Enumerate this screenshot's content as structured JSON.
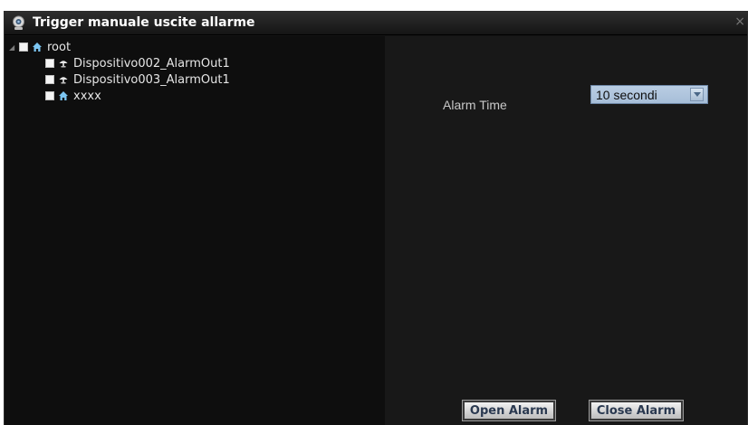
{
  "window": {
    "title": "Trigger manuale uscite allarme",
    "close_glyph": "×"
  },
  "tree": {
    "root": {
      "label": "root",
      "icon": "home-icon",
      "checked": false,
      "expanded": true
    },
    "items": [
      {
        "label": "Dispositivo002_AlarmOut1",
        "icon": "alarm-output-icon",
        "checked": false
      },
      {
        "label": "Dispositivo003_AlarmOut1",
        "icon": "alarm-output-icon",
        "checked": false
      },
      {
        "label": "xxxx",
        "icon": "home-icon",
        "checked": false
      }
    ]
  },
  "settings": {
    "alarm_time_label": "Alarm Time",
    "alarm_time_value": "10 secondi"
  },
  "buttons": {
    "open_label": "Open Alarm",
    "close_label": "Close Alarm"
  },
  "colors": {
    "background": "#141414",
    "select_bg": "#b3c8df",
    "button_text": "#2a3950",
    "home_icon": "#7cc6f2"
  }
}
